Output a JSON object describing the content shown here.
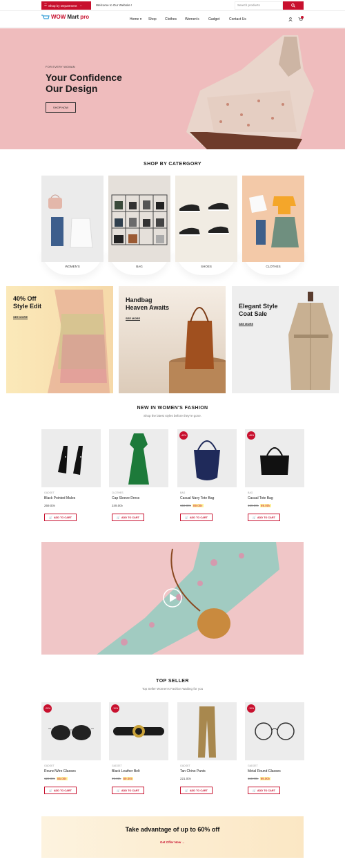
{
  "topbar": {
    "department_label": "Shop by Department",
    "welcome": "Welcome to Our Website !",
    "search_placeholder": "Search products"
  },
  "logo": {
    "part1": "WOW",
    "part2": "Mart",
    "part3": "pro"
  },
  "nav": [
    "Home",
    "Shop",
    "Clothes",
    "Women's",
    "Gadget",
    "Contact Us"
  ],
  "hero": {
    "tag": "FOR EVERY WOMAN",
    "title_line1": "Your Confidence",
    "title_line2": "Our Design",
    "button": "SHOP NOW"
  },
  "categories_section": {
    "title": "SHOP BY CATERGORY",
    "items": [
      "WOMEN'S",
      "BAG",
      "SHOES",
      "CLOTHES"
    ]
  },
  "promos": [
    {
      "line1": "40% Off",
      "line2": "Style Edit",
      "link": "SEE MORE"
    },
    {
      "line1": "Handbag",
      "line2": "Heaven Awaits",
      "link": "SEE MORE"
    },
    {
      "line1": "Elegant Style",
      "line2": "Coat Sale",
      "link": "SEE MORE"
    }
  ],
  "new_in": {
    "title": "NEW IN WOMEN'S FASHION",
    "subtitle": "Shop the latest styles before they're gone.",
    "products": [
      {
        "category": "GADGET",
        "name": "Black Pointed Mules",
        "price": "269.00৳",
        "old": "",
        "badge": ""
      },
      {
        "category": "CLOTHES",
        "name": "Cap Sleeve Dress",
        "price": "249.00৳",
        "old": "",
        "badge": ""
      },
      {
        "category": "BAG",
        "name": "Casual Navy Tote Bag",
        "price": "89.00৳",
        "old": "150.00৳",
        "badge": "-40%"
      },
      {
        "category": "BAG",
        "name": "Casual Tote Bag",
        "price": "89.00৳",
        "old": "169.00৳",
        "badge": "-48%"
      }
    ],
    "cart_label": "ADD TO CART"
  },
  "top_seller": {
    "title": "TOP SELLER",
    "subtitle": "Top Seller Women's Fashion Waiting for you",
    "products": [
      {
        "category": "GADGET",
        "name": "Round Wire Glasses",
        "price": "85.00৳",
        "old": "120.00৳",
        "badge": "-29%"
      },
      {
        "category": "GADGET",
        "name": "Black Leather Belt",
        "price": "89.00৳",
        "old": "99.00৳",
        "badge": "-10%"
      },
      {
        "category": "GADGET",
        "name": "Tan Chino Pants",
        "price": "221.00৳",
        "old": "",
        "badge": ""
      },
      {
        "category": "GADGET",
        "name": "Metal Round Glasses",
        "price": "99.00৳",
        "old": "110.00৳",
        "badge": "-10%"
      }
    ],
    "cart_label": "ADD TO CART"
  },
  "offer": {
    "title": "Take advantage of up to 60% off",
    "link": "Get Offer Now →"
  },
  "colors": {
    "accent": "#c8102e",
    "hero_bg": "#efbcbd"
  }
}
